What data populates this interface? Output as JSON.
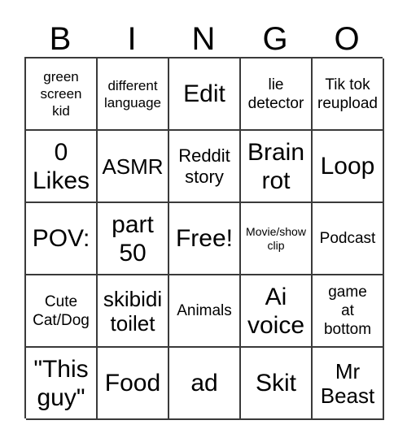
{
  "card": {
    "header_letters": [
      "B",
      "I",
      "N",
      "G",
      "O"
    ],
    "columns": 5,
    "rows": 5,
    "grid_line_color": "#3a3a3a",
    "text_color": "#000000",
    "background_color": "#ffffff",
    "cells": [
      [
        {
          "text": "green\nscreen\nkid",
          "size": "sm"
        },
        {
          "text": "different\nlanguage",
          "size": "sm"
        },
        {
          "text": "Edit",
          "size": "xxl"
        },
        {
          "text": "lie\ndetector",
          "size": "md"
        },
        {
          "text": "Tik tok\nreupload",
          "size": "md"
        }
      ],
      [
        {
          "text": "0\nLikes",
          "size": "xxl"
        },
        {
          "text": "ASMR",
          "size": "xl"
        },
        {
          "text": "Reddit\nstory",
          "size": "lg"
        },
        {
          "text": "Brain\nrot",
          "size": "xxl"
        },
        {
          "text": "Loop",
          "size": "xxl"
        }
      ],
      [
        {
          "text": "POV:",
          "size": "xxl"
        },
        {
          "text": "part\n50",
          "size": "xxl"
        },
        {
          "text": "Free!",
          "size": "xxl"
        },
        {
          "text": "Movie/show\nclip",
          "size": "xs"
        },
        {
          "text": "Podcast",
          "size": "md"
        }
      ],
      [
        {
          "text": "Cute\nCat/Dog",
          "size": "md"
        },
        {
          "text": "skibidi\ntoilet",
          "size": "xl"
        },
        {
          "text": "Animals",
          "size": "md"
        },
        {
          "text": "Ai\nvoice",
          "size": "xxl"
        },
        {
          "text": "game\nat\nbottom",
          "size": "md"
        }
      ],
      [
        {
          "text": "\"This\nguy\"",
          "size": "xxl"
        },
        {
          "text": "Food",
          "size": "xxl"
        },
        {
          "text": "ad",
          "size": "xxl"
        },
        {
          "text": "Skit",
          "size": "xxl"
        },
        {
          "text": "Mr\nBeast",
          "size": "xl"
        }
      ]
    ]
  }
}
